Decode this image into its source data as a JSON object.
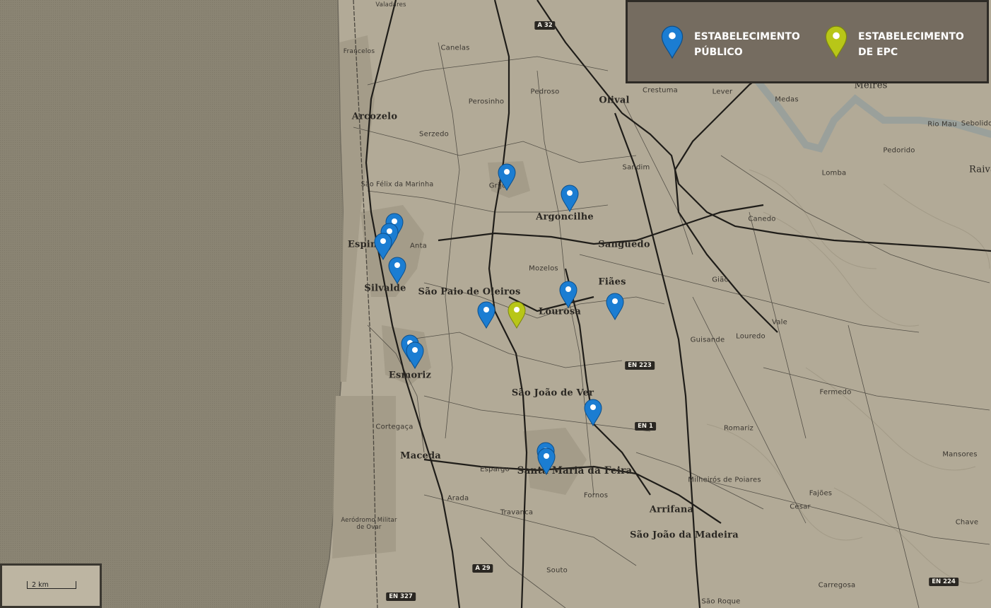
{
  "legend": {
    "public": {
      "line1": "ESTABELECIMENTO",
      "line2": "PÚBLICO"
    },
    "epc": {
      "line1": "ESTABELECIMENTO",
      "line2": "DE EPC"
    }
  },
  "scale": {
    "label": "2 km"
  },
  "colors": {
    "land": "#b2aa97",
    "sea": "#8a8473",
    "river": "#9aa09b",
    "pin_public": "#1b7dd2",
    "pin_epc": "#b8c618",
    "legend_bg": "#756c60"
  },
  "places": {
    "valadares": "Valadares",
    "francelos": "Francelos",
    "canelas": "Canelas",
    "pedroso": "Pedroso",
    "perosinho": "Perosinho",
    "olival": "Olival",
    "crestuma": "Crestuma",
    "lever": "Lever",
    "medas": "Medas",
    "melres": "Melres",
    "rio_mau": "Rio Mau",
    "sebolido": "Sebolido",
    "pedorido": "Pedorido",
    "raiva": "Raiva",
    "lomba": "Lomba",
    "arcozelo": "Arcozelo",
    "serzedo": "Serzedo",
    "sandim": "Sandim",
    "sao_felix": "São Félix da Marinha",
    "grijo": "Grijó",
    "argoncilhe": "Argoncilhe",
    "canedo": "Canedo",
    "sanguedo": "Sanguedo",
    "espinho": "Espinho",
    "anta": "Anta",
    "mozelos": "Mozelos",
    "silvalde": "Silvalde",
    "sao_paio": "São Paio de Oleiros",
    "fiaes": "Fiães",
    "lourosa": "Lourosa",
    "giao": "Gião",
    "vale": "Vale",
    "louredo": "Louredo",
    "guisande": "Guisande",
    "esmoriz": "Esmoriz",
    "sao_joao_ver": "São João de Ver",
    "fermedo": "Fermedo",
    "cortegaca": "Cortegaça",
    "romariz": "Romariz",
    "macedo": "Maceda",
    "espargo": "Espargo",
    "santa_maria": "Santa Maria da Feira",
    "mansores": "Mansores",
    "milheiros": "Milheirós de Poiares",
    "fajoes": "Fajões",
    "arada": "Arada",
    "fornos": "Fornos",
    "cesar": "Cesar",
    "travanca": "Travanca",
    "arrifana": "Arrifana",
    "chave": "Chave",
    "aerodromo": "Aeródromo Militar de Ovar",
    "sao_joao_madeira": "São João da Madeira",
    "souto": "Souto",
    "carregosa": "Carregosa",
    "sao_roque": "São Roque"
  },
  "roads": {
    "a32": "A 32",
    "en223": "EN 223",
    "en1": "EN 1",
    "a29": "A 29",
    "en224": "EN 224",
    "en327": "EN 327"
  }
}
